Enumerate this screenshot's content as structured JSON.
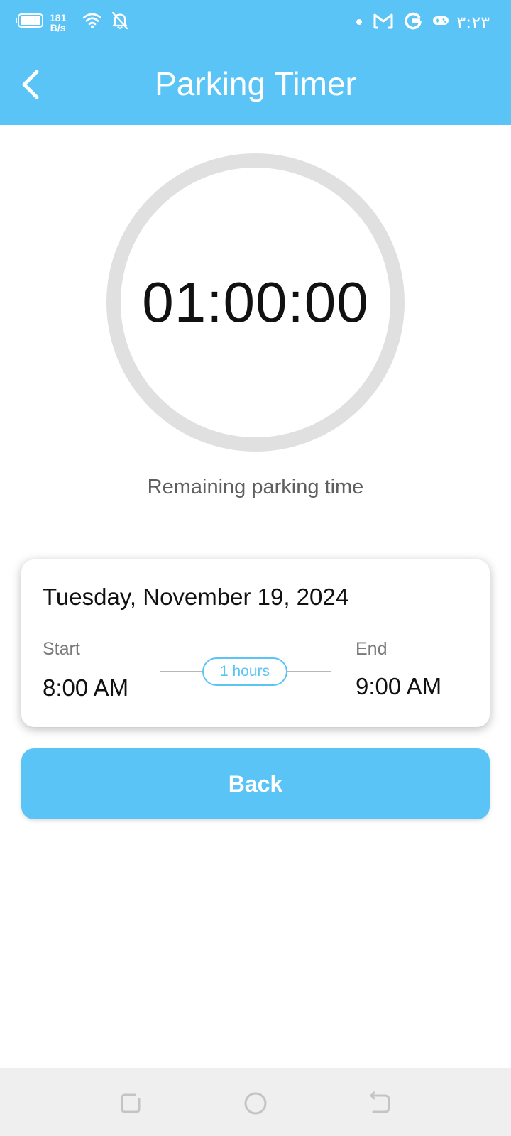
{
  "status_bar": {
    "net_speed_value": "181",
    "net_speed_unit": "B/s",
    "time": "۳:۲۳",
    "icons": [
      "battery-icon",
      "wifi-icon",
      "notifications-off-icon",
      "dot-icon",
      "gmail-icon",
      "google-icon",
      "game-controller-icon"
    ]
  },
  "app_bar": {
    "title": "Parking Timer",
    "back_icon": "chevron-left-icon"
  },
  "timer": {
    "value": "01:00:00",
    "caption": "Remaining parking time"
  },
  "session": {
    "date": "Tuesday, November 19, 2024",
    "start_label": "Start",
    "start_time": "8:00 AM",
    "end_label": "End",
    "end_time": "9:00 AM",
    "duration": "1 hours"
  },
  "actions": {
    "back_label": "Back"
  },
  "nav_bar": {
    "icons": [
      "recents-icon",
      "home-icon",
      "back-icon"
    ]
  },
  "colors": {
    "primary": "#5bc4f7",
    "ring": "#e0e0e0",
    "nav_background": "#efefef"
  }
}
